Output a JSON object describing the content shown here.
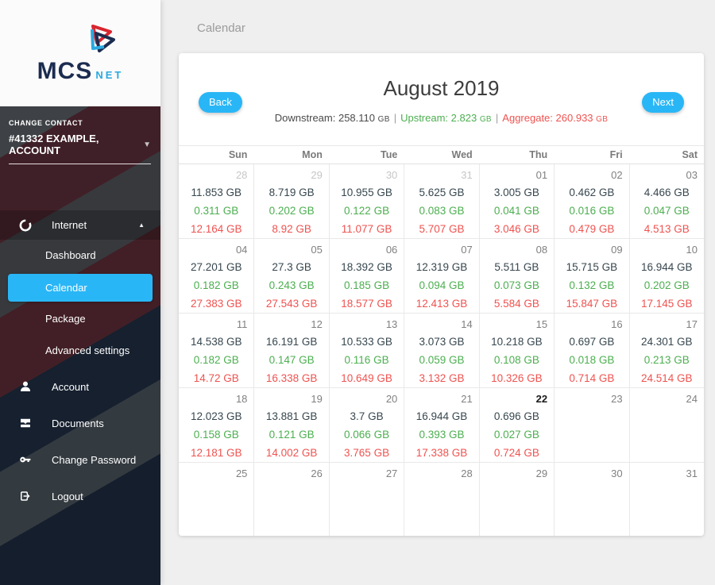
{
  "colors": {
    "accent_blue": "#29b6f6",
    "downstream": "#37474f",
    "upstream": "#4caf50",
    "aggregate": "#ef5350",
    "brand_navy": "#1c2c50",
    "brand_lightblue": "#2aa9e0",
    "brand_red": "#d8252f"
  },
  "icons": {
    "internet": "data-usage-icon",
    "account": "person-icon",
    "documents": "documents-icon",
    "change_password": "key-icon",
    "logout": "logout-icon",
    "contact": "caret-down-icon",
    "group_state": "caret-up-icon"
  },
  "sidebar": {
    "logo": {
      "primary": "MCS",
      "secondary": "NET"
    },
    "change_contact_label": "CHANGE CONTACT",
    "contact_value": "#41332 EXAMPLE, ACCOUNT",
    "internet": {
      "label": "Internet",
      "items": [
        {
          "label": "Dashboard",
          "active": false
        },
        {
          "label": "Calendar",
          "active": true
        },
        {
          "label": "Package",
          "active": false
        },
        {
          "label": "Advanced settings",
          "active": false
        }
      ]
    },
    "menu": [
      {
        "label": "Account"
      },
      {
        "label": "Documents"
      },
      {
        "label": "Change Password"
      },
      {
        "label": "Logout"
      }
    ]
  },
  "header": {
    "title": "Calendar"
  },
  "calendar": {
    "month_title": "August 2019",
    "back_label": "Back",
    "next_label": "Next",
    "summary": {
      "downstream_label": "Downstream:",
      "downstream_value": "258.110",
      "upstream_label": "Upstream:",
      "upstream_value": "2.823",
      "aggregate_label": "Aggregate:",
      "aggregate_value": "260.933",
      "unit": "GB",
      "separator": "|"
    },
    "weekdays": [
      "Sun",
      "Mon",
      "Tue",
      "Wed",
      "Thu",
      "Fri",
      "Sat"
    ],
    "days": [
      {
        "num": "28",
        "other_month": true,
        "downstream": "11.853 GB",
        "upstream": "0.311 GB",
        "aggregate": "12.164 GB"
      },
      {
        "num": "29",
        "other_month": true,
        "downstream": "8.719 GB",
        "upstream": "0.202 GB",
        "aggregate": "8.92 GB"
      },
      {
        "num": "30",
        "other_month": true,
        "downstream": "10.955 GB",
        "upstream": "0.122 GB",
        "aggregate": "11.077 GB"
      },
      {
        "num": "31",
        "other_month": true,
        "downstream": "5.625 GB",
        "upstream": "0.083 GB",
        "aggregate": "5.707 GB"
      },
      {
        "num": "01",
        "downstream": "3.005 GB",
        "upstream": "0.041 GB",
        "aggregate": "3.046 GB"
      },
      {
        "num": "02",
        "downstream": "0.462 GB",
        "upstream": "0.016 GB",
        "aggregate": "0.479 GB"
      },
      {
        "num": "03",
        "downstream": "4.466 GB",
        "upstream": "0.047 GB",
        "aggregate": "4.513 GB"
      },
      {
        "num": "04",
        "downstream": "27.201 GB",
        "upstream": "0.182 GB",
        "aggregate": "27.383 GB"
      },
      {
        "num": "05",
        "downstream": "27.3 GB",
        "upstream": "0.243 GB",
        "aggregate": "27.543 GB"
      },
      {
        "num": "06",
        "downstream": "18.392 GB",
        "upstream": "0.185 GB",
        "aggregate": "18.577 GB"
      },
      {
        "num": "07",
        "downstream": "12.319 GB",
        "upstream": "0.094 GB",
        "aggregate": "12.413 GB"
      },
      {
        "num": "08",
        "downstream": "5.511 GB",
        "upstream": "0.073 GB",
        "aggregate": "5.584 GB"
      },
      {
        "num": "09",
        "downstream": "15.715 GB",
        "upstream": "0.132 GB",
        "aggregate": "15.847 GB"
      },
      {
        "num": "10",
        "downstream": "16.944 GB",
        "upstream": "0.202 GB",
        "aggregate": "17.145 GB"
      },
      {
        "num": "11",
        "downstream": "14.538 GB",
        "upstream": "0.182 GB",
        "aggregate": "14.72 GB"
      },
      {
        "num": "12",
        "downstream": "16.191 GB",
        "upstream": "0.147 GB",
        "aggregate": "16.338 GB"
      },
      {
        "num": "13",
        "downstream": "10.533 GB",
        "upstream": "0.116 GB",
        "aggregate": "10.649 GB"
      },
      {
        "num": "14",
        "downstream": "3.073 GB",
        "upstream": "0.059 GB",
        "aggregate": "3.132 GB"
      },
      {
        "num": "15",
        "downstream": "10.218 GB",
        "upstream": "0.108 GB",
        "aggregate": "10.326 GB"
      },
      {
        "num": "16",
        "downstream": "0.697 GB",
        "upstream": "0.018 GB",
        "aggregate": "0.714 GB"
      },
      {
        "num": "17",
        "downstream": "24.301 GB",
        "upstream": "0.213 GB",
        "aggregate": "24.514 GB"
      },
      {
        "num": "18",
        "downstream": "12.023 GB",
        "upstream": "0.158 GB",
        "aggregate": "12.181 GB"
      },
      {
        "num": "19",
        "downstream": "13.881 GB",
        "upstream": "0.121 GB",
        "aggregate": "14.002 GB"
      },
      {
        "num": "20",
        "downstream": "3.7 GB",
        "upstream": "0.066 GB",
        "aggregate": "3.765 GB"
      },
      {
        "num": "21",
        "downstream": "16.944 GB",
        "upstream": "0.393 GB",
        "aggregate": "17.338 GB"
      },
      {
        "num": "22",
        "today": true,
        "downstream": "0.696 GB",
        "upstream": "0.027 GB",
        "aggregate": "0.724 GB"
      },
      {
        "num": "23"
      },
      {
        "num": "24"
      },
      {
        "num": "25"
      },
      {
        "num": "26"
      },
      {
        "num": "27"
      },
      {
        "num": "28"
      },
      {
        "num": "29"
      },
      {
        "num": "30"
      },
      {
        "num": "31"
      }
    ]
  }
}
